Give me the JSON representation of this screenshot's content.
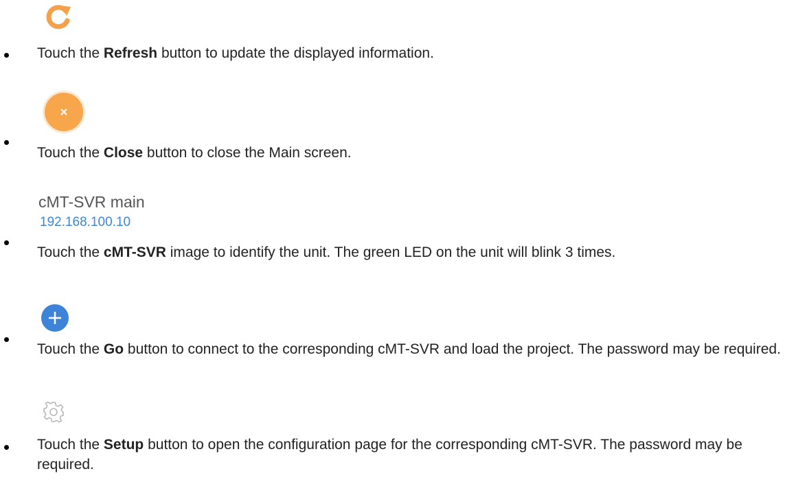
{
  "items": [
    {
      "icon": "refresh-icon",
      "pre": "Touch the ",
      "bold": "Refresh",
      "post": " button to update the displayed information."
    },
    {
      "icon": "close-icon",
      "pre": "Touch the ",
      "bold": "Close",
      "post": " button to close the Main screen."
    },
    {
      "icon": "device-label",
      "device_name": "cMT-SVR main",
      "device_ip": "192.168.100.10",
      "pre": "Touch the ",
      "bold": "cMT-SVR",
      "post": " image to identify the unit. The green LED on the unit will blink 3 times."
    },
    {
      "icon": "go-icon",
      "pre": "Touch the ",
      "bold": "Go",
      "post": " button to connect to the corresponding cMT-SVR and load the project. The password may be required."
    },
    {
      "icon": "gear-icon",
      "pre": "Touch the ",
      "bold": "Setup",
      "post": " button to open the configuration page for the corresponding cMT-SVR. The password may be required."
    }
  ],
  "colors": {
    "refresh_orange": "#f5a04a",
    "close_orange": "#f8a64c",
    "go_blue": "#3d84d8",
    "gear_gray": "#b8b8b8",
    "ip_blue": "#3a86d8"
  }
}
